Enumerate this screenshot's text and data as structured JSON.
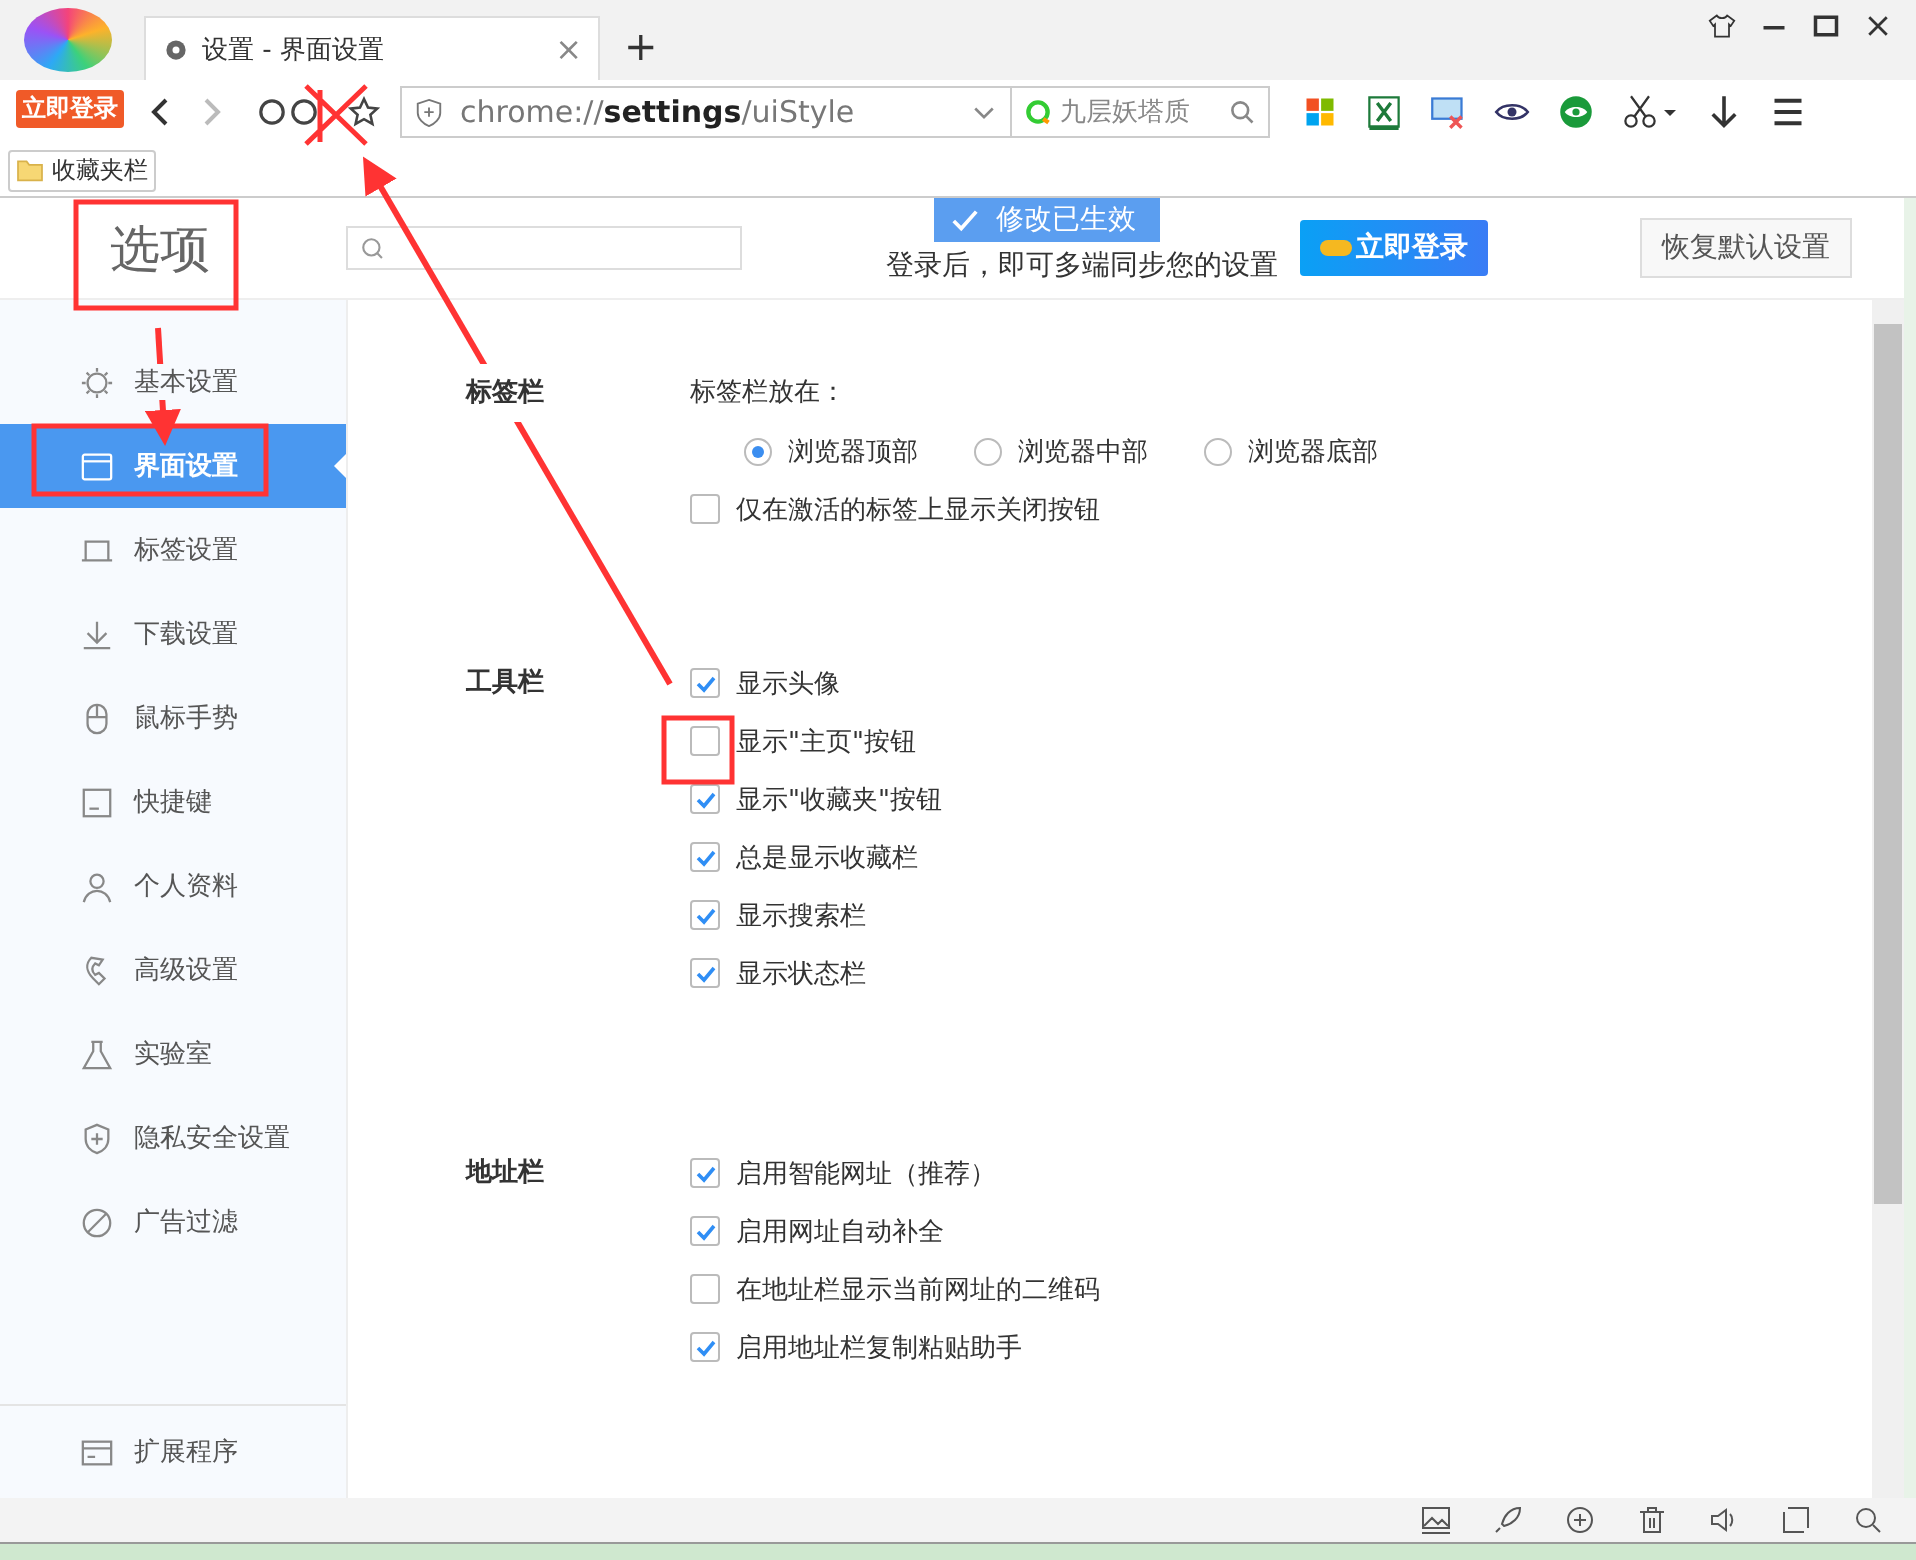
{
  "browser": {
    "login_badge": "立即登录",
    "tab": {
      "title": "设置 - 界面设置",
      "close": "×"
    },
    "new_tab": "+",
    "url": {
      "scheme": "chrome://",
      "host": "settings",
      "path": "/uiStyle"
    },
    "search": {
      "value": "九层妖塔质"
    },
    "bookmarks": [
      {
        "label": "收藏夹栏"
      }
    ]
  },
  "toast": "修改已生效",
  "header": {
    "title": "选项",
    "sync_text": "登录后，即可多端同步您的设置",
    "login_button": "立即登录",
    "reset_button": "恢复默认设置"
  },
  "sidebar": {
    "items": [
      {
        "label": "基本设置",
        "selected": false
      },
      {
        "label": "界面设置",
        "selected": true
      },
      {
        "label": "标签设置",
        "selected": false
      },
      {
        "label": "下载设置",
        "selected": false
      },
      {
        "label": "鼠标手势",
        "selected": false
      },
      {
        "label": "快捷键",
        "selected": false
      },
      {
        "label": "个人资料",
        "selected": false
      },
      {
        "label": "高级设置",
        "selected": false
      },
      {
        "label": "实验室",
        "selected": false
      },
      {
        "label": "隐私安全设置",
        "selected": false
      },
      {
        "label": "广告过滤",
        "selected": false
      }
    ],
    "footer": "扩展程序"
  },
  "sections": [
    {
      "title": "标签栏",
      "rows": [
        {
          "kind": "label",
          "text": "标签栏放在："
        },
        {
          "kind": "radios",
          "options": [
            {
              "label": "浏览器顶部",
              "selected": true
            },
            {
              "label": "浏览器中部",
              "selected": false
            },
            {
              "label": "浏览器底部",
              "selected": false
            }
          ]
        },
        {
          "kind": "checkbox",
          "label": "仅在激活的标签上显示关闭按钮",
          "checked": false
        }
      ]
    },
    {
      "title": "工具栏",
      "rows": [
        {
          "kind": "checkbox",
          "label": "显示头像",
          "checked": true
        },
        {
          "kind": "checkbox",
          "label": "显示\"主页\"按钮",
          "checked": false
        },
        {
          "kind": "checkbox",
          "label": "显示\"收藏夹\"按钮",
          "checked": true
        },
        {
          "kind": "checkbox",
          "label": "总是显示收藏栏",
          "checked": true
        },
        {
          "kind": "checkbox",
          "label": "显示搜索栏",
          "checked": true
        },
        {
          "kind": "checkbox",
          "label": "显示状态栏",
          "checked": true
        }
      ]
    },
    {
      "title": "地址栏",
      "rows": [
        {
          "kind": "checkbox",
          "label": "启用智能网址（推荐）",
          "checked": true
        },
        {
          "kind": "checkbox",
          "label": "启用网址自动补全",
          "checked": true
        },
        {
          "kind": "checkbox",
          "label": "在地址栏显示当前网址的二维码",
          "checked": false
        },
        {
          "kind": "checkbox",
          "label": "启用地址栏复制粘贴助手",
          "checked": true
        }
      ]
    }
  ]
}
